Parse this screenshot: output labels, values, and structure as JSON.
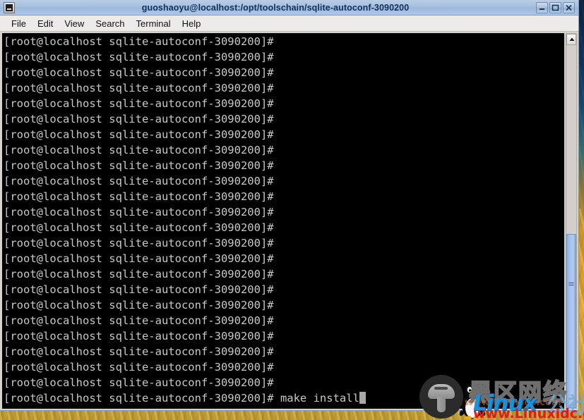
{
  "window": {
    "title": "guoshaoyu@localhost:/opt/toolschain/sqlite-autoconf-3090200",
    "icon": "terminal-icon",
    "buttons": {
      "minimize": "minimize-button",
      "maximize": "maximize-button",
      "close": "close-button"
    }
  },
  "menubar": {
    "items": [
      {
        "label": "File"
      },
      {
        "label": "Edit"
      },
      {
        "label": "View"
      },
      {
        "label": "Search"
      },
      {
        "label": "Terminal"
      },
      {
        "label": "Help"
      }
    ]
  },
  "terminal": {
    "prompt": "[root@localhost sqlite-autoconf-3090200]# ",
    "command": "make install",
    "foreground_color": "#c8c8c8",
    "background_color": "#000000",
    "cursor": "block",
    "lines": [
      "[root@localhost sqlite-autoconf-3090200]# ",
      "[root@localhost sqlite-autoconf-3090200]# ",
      "[root@localhost sqlite-autoconf-3090200]# ",
      "[root@localhost sqlite-autoconf-3090200]# ",
      "[root@localhost sqlite-autoconf-3090200]# ",
      "[root@localhost sqlite-autoconf-3090200]# ",
      "[root@localhost sqlite-autoconf-3090200]# ",
      "[root@localhost sqlite-autoconf-3090200]# ",
      "[root@localhost sqlite-autoconf-3090200]# ",
      "[root@localhost sqlite-autoconf-3090200]# ",
      "[root@localhost sqlite-autoconf-3090200]# ",
      "[root@localhost sqlite-autoconf-3090200]# ",
      "[root@localhost sqlite-autoconf-3090200]# ",
      "[root@localhost sqlite-autoconf-3090200]# ",
      "[root@localhost sqlite-autoconf-3090200]# ",
      "[root@localhost sqlite-autoconf-3090200]# ",
      "[root@localhost sqlite-autoconf-3090200]# ",
      "[root@localhost sqlite-autoconf-3090200]# ",
      "[root@localhost sqlite-autoconf-3090200]# ",
      "[root@localhost sqlite-autoconf-3090200]# ",
      "[root@localhost sqlite-autoconf-3090200]# ",
      "[root@localhost sqlite-autoconf-3090200]# ",
      "[root@localhost sqlite-autoconf-3090200]# "
    ]
  },
  "scrollbar": {
    "up_arrow": "scroll-up-arrow-icon",
    "thumb_grip": "scrollbar-grip-icon"
  },
  "watermark": {
    "cn_title": "黑区网络",
    "brand": "Linux",
    "cn_suffix": "公社",
    "url": "www.Linuxidc.com",
    "url_faint": "www.Linuxidc.com",
    "mushroom": "mushroom-icon",
    "tux": "tux-penguin-icon",
    "brand_color": "#1f8fd6",
    "url_color": "#e01b1b"
  }
}
